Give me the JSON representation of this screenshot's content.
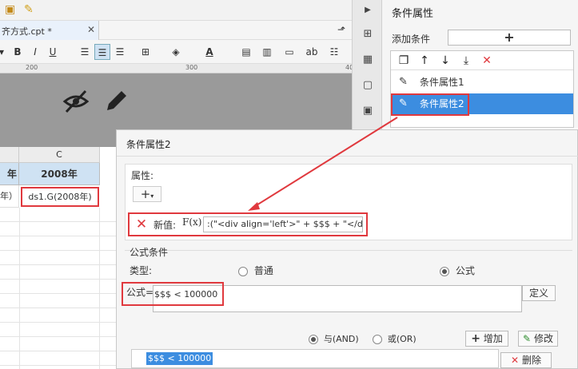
{
  "editor": {
    "tab_name": "齐方式.cpt *",
    "ruler_marks": [
      "200",
      "300",
      "40",
      "60"
    ],
    "columns": [
      "C"
    ],
    "header_cell_left": "年",
    "header_cell_c": "2008年",
    "data_cell_left": "年）",
    "data_cell_c": "ds1.G(2008年)"
  },
  "format_toolbar": {
    "bold": "B",
    "italic": "I",
    "underline": "U",
    "font_color": "A",
    "ab": "ab"
  },
  "right_panel": {
    "title": "条件属性",
    "add_label": "添加条件",
    "add_button": "+",
    "items": [
      "条件属性1",
      "条件属性2"
    ],
    "selected_index": 1
  },
  "dialog": {
    "title": "条件属性2",
    "attr_label": "属性:",
    "new_value_label": "新值:",
    "fx_label": "F(x)",
    "formula_value": ":(\"<div align='left'>\" + $$$ + \"</div>\")",
    "formula_cond_section": "公式条件",
    "type_label": "类型:",
    "type_normal": "普通",
    "type_formula": "公式",
    "formula_label": "公式=",
    "formula_input": "$$$ < 100000",
    "define_button": "定义",
    "and_label": "与(AND)",
    "or_label": "或(OR)",
    "add_button": "增加",
    "modify_button": "修改",
    "delete_button": "删除",
    "condition_item": "$$$ < 100000"
  },
  "colors": {
    "accent": "#3c8de0",
    "highlight": "#e0393e",
    "header_fill": "#cfe2f3"
  }
}
